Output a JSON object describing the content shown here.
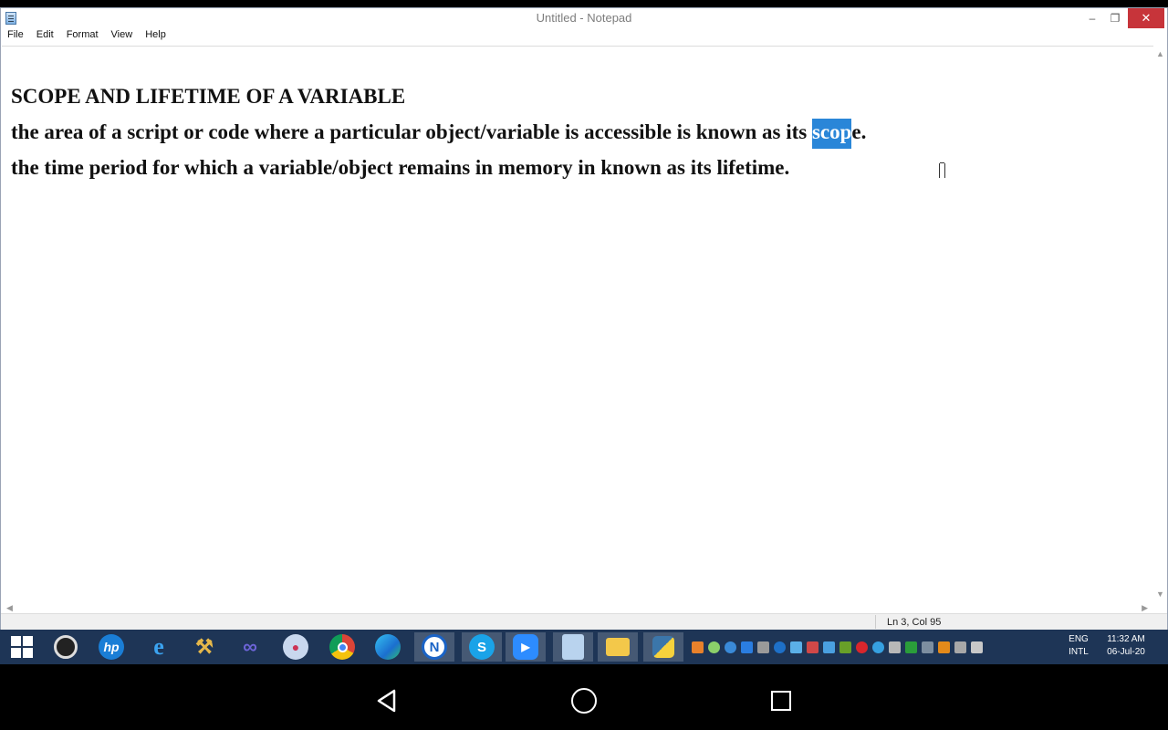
{
  "window": {
    "title": "Untitled - Notepad",
    "minimize_glyph": "–",
    "maximize_glyph": "❐",
    "close_glyph": "✕"
  },
  "menu": {
    "items": [
      {
        "label": "File"
      },
      {
        "label": "Edit"
      },
      {
        "label": "Format"
      },
      {
        "label": "View"
      },
      {
        "label": "Help"
      }
    ]
  },
  "document": {
    "line1": "SCOPE AND LIFETIME OF A VARIABLE",
    "line2_before": "the area of a script or code where a particular object/variable is accessible is known as its ",
    "line2_selected": "scop",
    "line2_after": "e.",
    "line3": "the time period for which a variable/object remains in memory in known as its lifetime."
  },
  "status": {
    "position": "Ln 3, Col 95"
  },
  "taskbar": {
    "apps": [
      {
        "icon": "windows-start-icon"
      },
      {
        "icon": "camera-icon"
      },
      {
        "icon": "hp-icon"
      },
      {
        "icon": "internet-explorer-icon"
      },
      {
        "icon": "tools-icon"
      },
      {
        "icon": "visual-studio-icon"
      },
      {
        "icon": "paint-icon"
      },
      {
        "icon": "chrome-icon"
      },
      {
        "icon": "edge-icon"
      },
      {
        "icon": "n-app-icon"
      },
      {
        "icon": "skype-icon"
      },
      {
        "icon": "zoom-icon"
      },
      {
        "icon": "notepad-icon"
      },
      {
        "icon": "file-explorer-icon"
      },
      {
        "icon": "python-icon"
      }
    ],
    "hp_label": "hp",
    "n_label": "N",
    "s_label": "S",
    "lang_line1": "ENG",
    "lang_line2": "INTL",
    "time": "11:32 AM",
    "date": "06-Jul-20"
  },
  "colors": {
    "selection": "#2a86d8",
    "taskbar": "#1e3556",
    "close_button": "#c7343a"
  }
}
